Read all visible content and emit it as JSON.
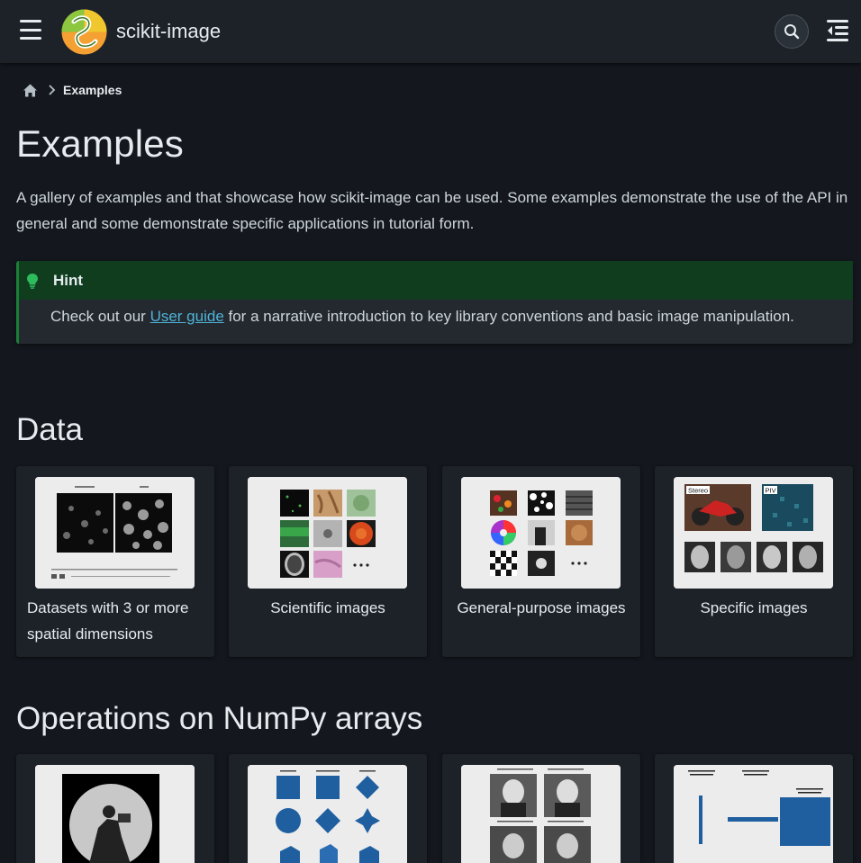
{
  "header": {
    "site_title": "scikit-image",
    "icons": [
      "hamburger-menu-icon",
      "scikit-image-logo",
      "search-icon",
      "toc-toggle-icon"
    ]
  },
  "breadcrumb": {
    "home_icon": "home-icon",
    "current": "Examples"
  },
  "page": {
    "title": "Examples",
    "intro": "A gallery of examples and that showcase how scikit-image can be used. Some examples demonstrate the use of the API in general and some demonstrate specific applications in tutorial form."
  },
  "hint": {
    "icon": "lightbulb-icon",
    "title": "Hint",
    "text_before": "Check out our ",
    "link": "User guide",
    "text_after": " for a narrative introduction to key library conventions and basic image manipulation."
  },
  "sections": [
    {
      "title": "Data",
      "cards": [
        {
          "label": "Datasets with 3 or more spatial dimensions"
        },
        {
          "label": "Scientific images"
        },
        {
          "label": "General-purpose images"
        },
        {
          "label": "Specific images",
          "thumb_text": [
            "Stereo",
            "PIV"
          ]
        }
      ]
    },
    {
      "title": "Operations on NumPy arrays",
      "cards": [
        {
          "label": ""
        },
        {
          "label": ""
        },
        {
          "label": ""
        },
        {
          "label": ""
        }
      ]
    }
  ],
  "colors": {
    "background": "#14181e",
    "header": "#1d2228",
    "hint_border": "#1a7f37",
    "hint_header": "#0f3d1e",
    "link": "#4fb3d9",
    "plot_blue": "#1f5fa0"
  }
}
